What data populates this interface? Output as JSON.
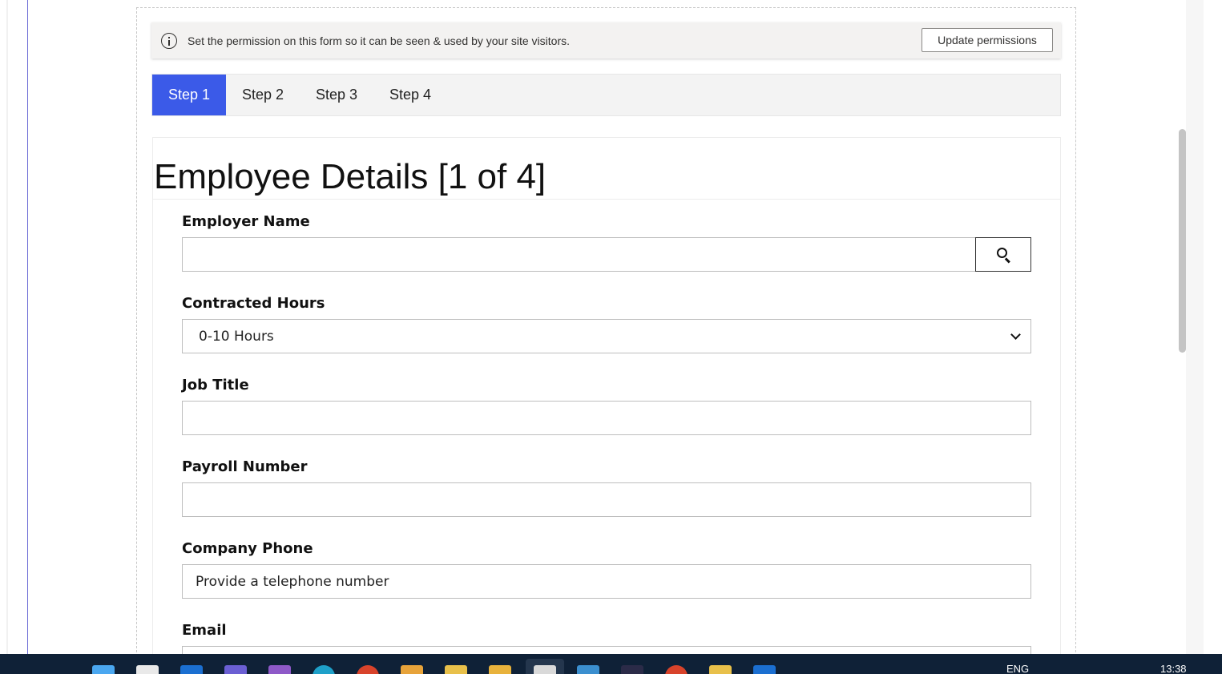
{
  "notice": {
    "text": "Set the permission on this form so it can be seen & used by your site visitors.",
    "button_label": "Update permissions",
    "icon": "info-icon"
  },
  "steps": [
    {
      "label": "Step 1",
      "active": true
    },
    {
      "label": "Step 2",
      "active": false
    },
    {
      "label": "Step 3",
      "active": false
    },
    {
      "label": "Step 4",
      "active": false
    }
  ],
  "form": {
    "title": "Employee Details [1 of 4]",
    "fields": {
      "employer_name": {
        "label": "Employer Name",
        "value": ""
      },
      "contracted_hours": {
        "label": "Contracted Hours",
        "value": "0-10 Hours"
      },
      "job_title": {
        "label": "Job Title",
        "value": ""
      },
      "payroll_number": {
        "label": "Payroll Number",
        "value": ""
      },
      "company_phone": {
        "label": "Company Phone",
        "placeholder": "Provide a telephone number"
      },
      "email": {
        "label": "Email"
      }
    }
  },
  "taskbar": {
    "language": "ENG",
    "time": "13:38"
  },
  "colors": {
    "active_step": "#3b5ae8",
    "taskbar": "#0f2137"
  }
}
